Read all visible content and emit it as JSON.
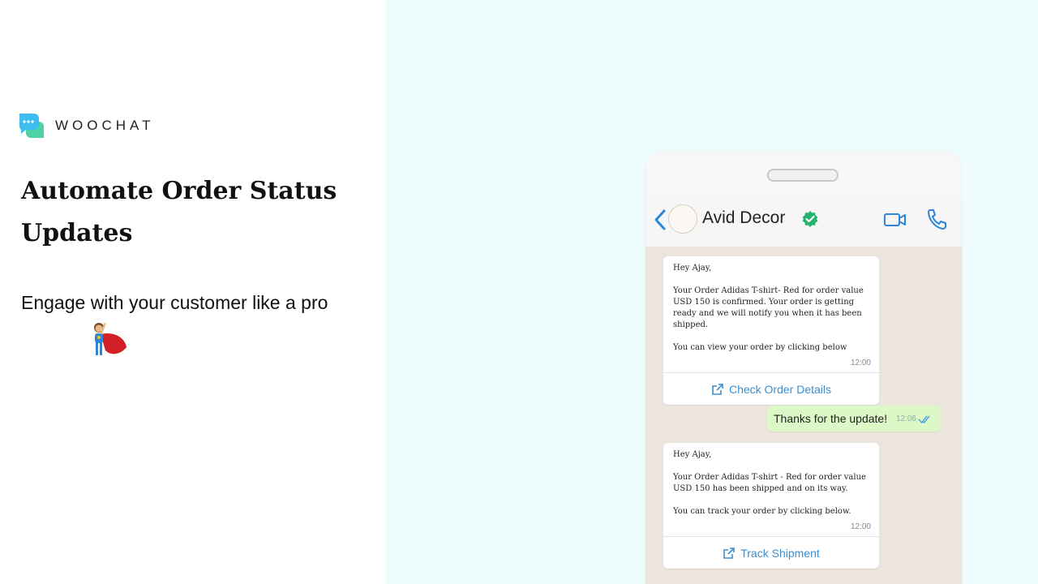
{
  "brand": {
    "name": "WOOCHAT"
  },
  "hero": {
    "headline": "Automate Order Status Updates",
    "subhead": "Engage with your customer like a pro"
  },
  "chat": {
    "contact_name": "Avid Decor",
    "messages": [
      {
        "text": "Hey Ajay,\n\nYour Order Adidas T-shirt- Red for order value USD 150 is confirmed. Your order is getting ready and we will notify you when it has been shipped.\n\nYou can view your order by clicking below",
        "time": "12:00",
        "button": "Check Order Details"
      },
      {
        "text": "Thanks for the update!",
        "time": "12:06"
      },
      {
        "text": "Hey Ajay,\n\nYour Order Adidas T-shirt - Red for order value USD 150 has been shipped and on its way.\n\nYou can track your order by clicking below.",
        "time": "12:00",
        "button": "Track Shipment"
      }
    ]
  },
  "colors": {
    "right_bg": "#effcfd",
    "accent_blue": "#3a8fd0",
    "whatsapp_green": "#25d366",
    "outgoing_bubble": "#dcf8c6"
  },
  "icons": [
    "chat-bubble-logo-icon",
    "superhero-icon",
    "back-chevron-icon",
    "verified-badge-icon",
    "video-call-icon",
    "phone-call-icon",
    "external-link-icon",
    "double-check-icon"
  ]
}
